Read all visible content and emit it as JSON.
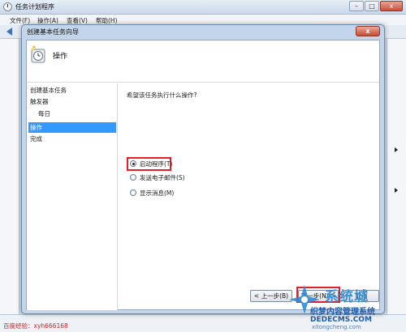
{
  "background_window": {
    "title": "任务计划程序",
    "controls": {
      "minimize": "–",
      "maximize": "□",
      "close": "x"
    },
    "menu": [
      "文件(F)",
      "操作(A)",
      "查看(V)",
      "帮助(H)"
    ],
    "status_text": "百度经验：xyh666168"
  },
  "wizard": {
    "title": "创建基本任务向导",
    "close_label": "x",
    "header_title": "操作",
    "nav": [
      {
        "label": "创建基本任务"
      },
      {
        "label": "触发器"
      },
      {
        "label": "每日"
      },
      {
        "label": "操作"
      },
      {
        "label": "完成"
      }
    ],
    "question": "希望该任务执行什么操作?",
    "options": [
      {
        "label": "启动程序(T)",
        "selected": true
      },
      {
        "label": "发送电子邮件(S)",
        "selected": false
      },
      {
        "label": "显示消息(M)",
        "selected": false
      }
    ],
    "buttons": {
      "back": "< 上一步(B)",
      "next": "下一步(N) >",
      "cancel": "取消"
    }
  },
  "watermark": {
    "brand": "系统城",
    "site_line1": "织梦内容管理系统",
    "site_line2": "DEDECMS.COM",
    "site_line3": "xitongcheng.com"
  }
}
